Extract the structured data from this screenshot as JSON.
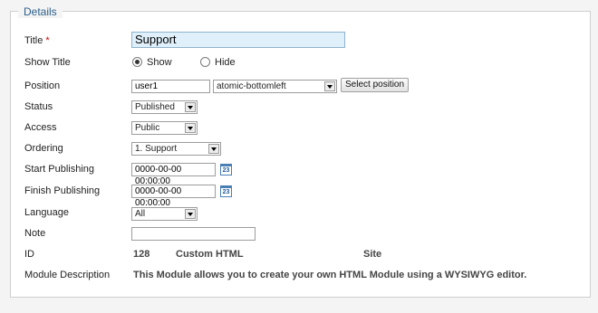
{
  "legend": "Details",
  "fields": {
    "title": {
      "label": "Title",
      "required": "*",
      "value": "Support"
    },
    "show_title": {
      "label": "Show Title",
      "options": [
        "Show",
        "Hide"
      ],
      "selected": "Show"
    },
    "position": {
      "label": "Position",
      "value": "user1",
      "select_value": "atomic-bottomleft",
      "button": "Select position"
    },
    "status": {
      "label": "Status",
      "value": "Published"
    },
    "access": {
      "label": "Access",
      "value": "Public"
    },
    "ordering": {
      "label": "Ordering",
      "value": "1. Support"
    },
    "start_publishing": {
      "label": "Start Publishing",
      "value": "0000-00-00 00:00:00",
      "icon": "calendar-icon"
    },
    "finish_publishing": {
      "label": "Finish Publishing",
      "value": "0000-00-00 00:00:00",
      "icon": "calendar-icon"
    },
    "language": {
      "label": "Language",
      "value": "All"
    },
    "note": {
      "label": "Note",
      "value": ""
    },
    "id": {
      "label": "ID",
      "value": "128",
      "type": "Custom HTML",
      "client": "Site"
    },
    "module_description": {
      "label": "Module Description",
      "value": "This Module allows you to create your own HTML Module using a WYSIWYG editor."
    }
  },
  "colors": {
    "legend": "#2c5f8b",
    "title_input_bg": "#dff0fb",
    "required": "#cc0000"
  }
}
